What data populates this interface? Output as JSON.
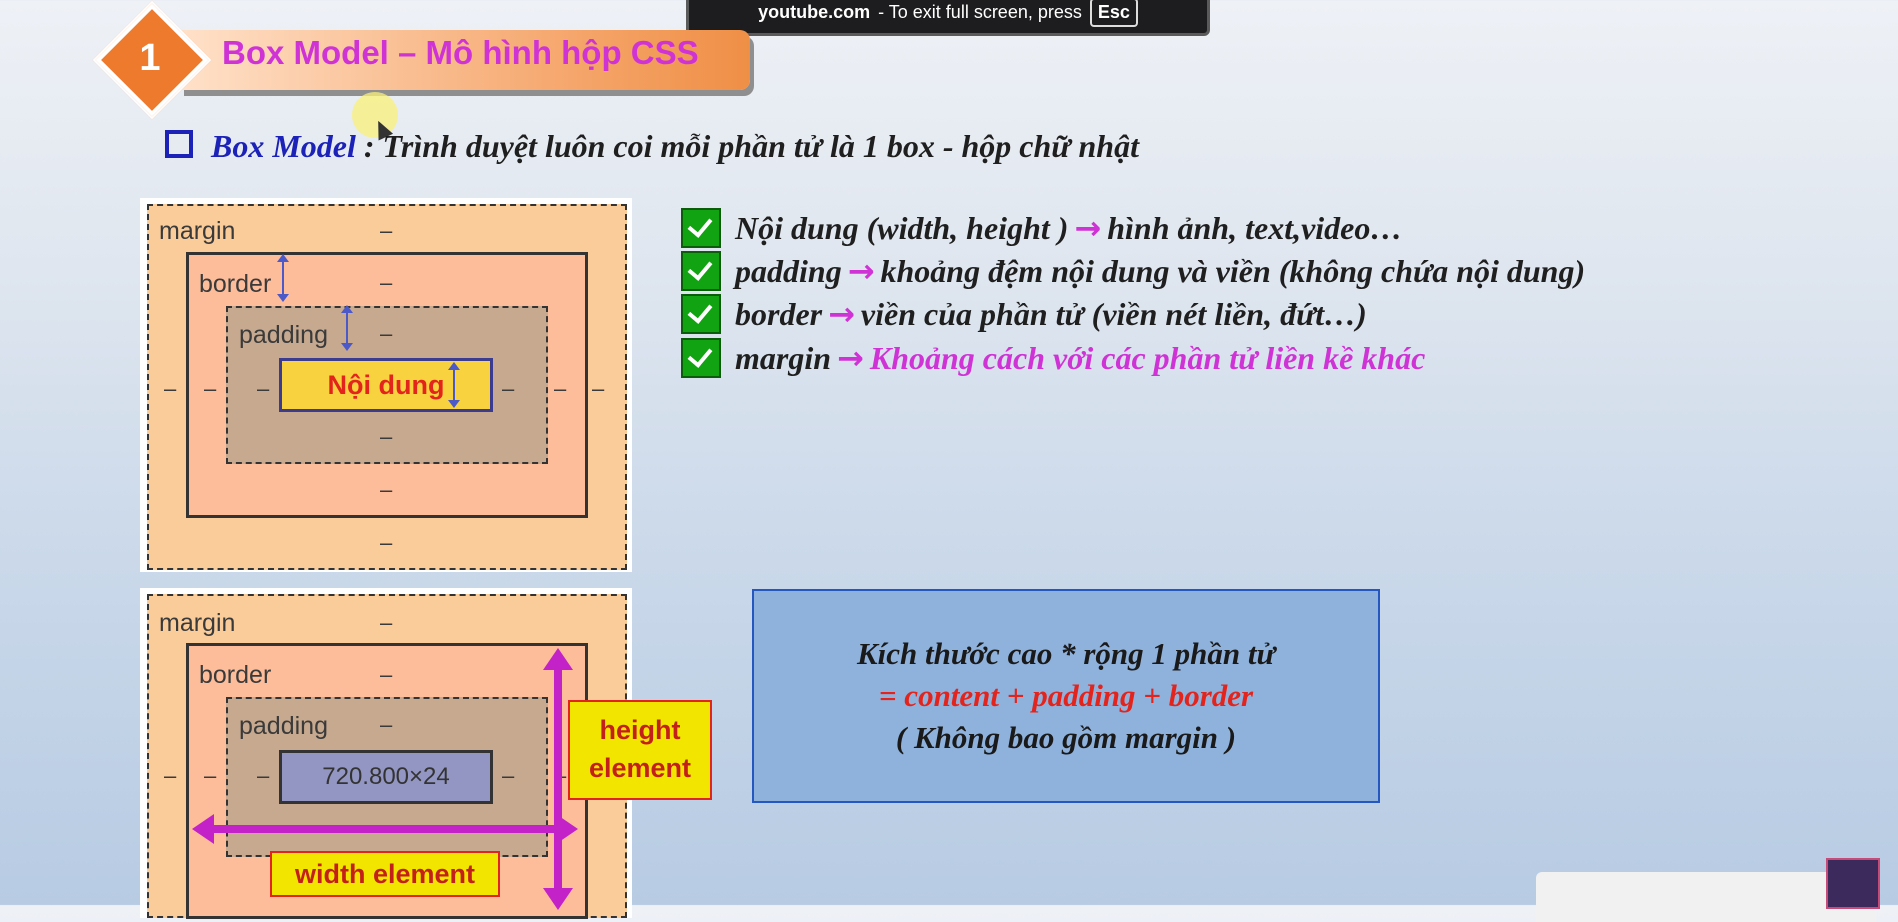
{
  "fullscreen_notice": {
    "site": "youtube.com",
    "text": "-  To exit full screen, press",
    "key": "Esc"
  },
  "title": {
    "number": "1",
    "text": "Box Model – Mô hình hộp CSS"
  },
  "subtitle": {
    "lead": "Box Model",
    "rest": ": Trình duyệt luôn coi mỗi phần tử là 1 box -  hộp chữ nhật"
  },
  "diagram1": {
    "margin": "margin",
    "border": "border",
    "padding": "padding",
    "content": "Nội dung",
    "dash": "–"
  },
  "diagram2": {
    "margin": "margin",
    "border": "border",
    "padding": "padding",
    "content": "720.800×24",
    "dash": "–",
    "height_label": "height element",
    "width_label": "width element"
  },
  "bullets": [
    {
      "key": "Nội dung (width, height )",
      "arrow": "→",
      "desc": "hình ảnh, text,video…"
    },
    {
      "key": "padding",
      "arrow": "→",
      "desc": "khoảng đệm nội dung và viền (không chứa nội dung)"
    },
    {
      "key": "border",
      "arrow": "→",
      "desc": "viền của phần tử (viền nét liền, đứt…)"
    },
    {
      "key": "margin",
      "arrow": "→",
      "desc": "Khoảng cách với các phần tử liền kề khác"
    }
  ],
  "size_box": {
    "line1": "Kích thước cao * rộng 1 phần tử",
    "line2": "= content + padding + border",
    "line3": "( Không bao gồm margin )"
  },
  "colors": {
    "accent_pink": "#cf33d6",
    "check_green": "#11a311",
    "title_orange": "#ee7a2e"
  }
}
